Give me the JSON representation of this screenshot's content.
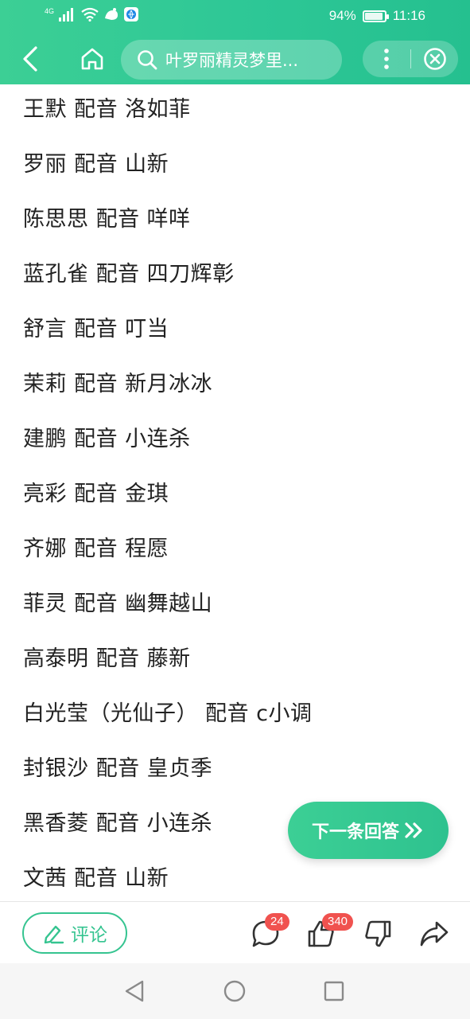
{
  "status_bar": {
    "signal_label": "4G",
    "battery_text": "94%",
    "battery_level": 0.94,
    "time": "11:16"
  },
  "top_bar": {
    "search_text": "叶罗丽精灵梦里...",
    "icons": [
      "back-icon",
      "home-icon",
      "search-icon",
      "more-icon",
      "close-icon"
    ]
  },
  "content": {
    "lines": [
      "王默 配音 洛如菲",
      "罗丽 配音 山新",
      "陈思思 配音 咩咩",
      "蓝孔雀 配音 四刀辉彰",
      "舒言 配音 叮当",
      "茉莉 配音 新月冰冰",
      "建鹏 配音 小连杀",
      "亮彩 配音 金琪",
      "齐娜 配音 程愿",
      "菲灵 配音 幽舞越山",
      "高泰明 配音 藤新",
      "白光莹（光仙子） 配音 c小调",
      "封银沙 配音 皇贞季",
      "黑香菱 配音 小连杀",
      "文茜 配音 山新"
    ]
  },
  "next_answer": {
    "label": "下一条回答"
  },
  "action_bar": {
    "comment_label": "评论",
    "comment_count": "24",
    "like_count": "340"
  },
  "colors": {
    "brand": "#2dc796",
    "badge": "#f0524f",
    "text": "#222222"
  }
}
